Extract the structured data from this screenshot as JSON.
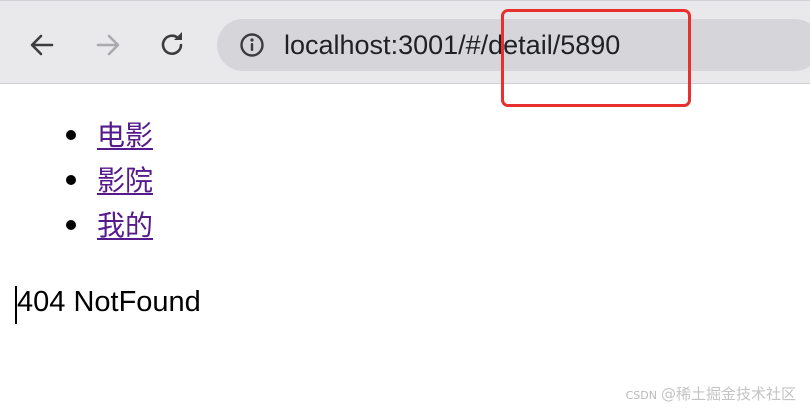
{
  "browser": {
    "url": "localhost:3001/#/detail/5890",
    "back_icon": "arrow-left",
    "forward_icon": "arrow-right",
    "reload_icon": "reload",
    "site_info_icon": "info-circle"
  },
  "annotation": {
    "highlight_color": "#e8312e"
  },
  "nav": {
    "items": [
      {
        "label": "电影"
      },
      {
        "label": "影院"
      },
      {
        "label": "我的"
      }
    ],
    "link_color": "#551a8b"
  },
  "main": {
    "message": "404 NotFound"
  },
  "watermark": {
    "source": "CSDN",
    "text": "@稀土掘金技术社区"
  }
}
